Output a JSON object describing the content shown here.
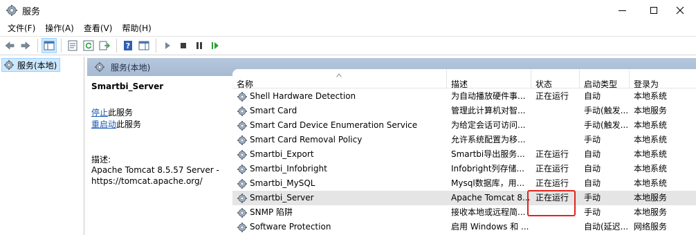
{
  "window": {
    "title": "服务"
  },
  "menu": [
    "文件(F)",
    "操作(A)",
    "查看(V)",
    "帮助(H)"
  ],
  "toolbar": {
    "icons": [
      "back-arrow-icon",
      "forward-arrow-icon",
      "show-console-tree-icon",
      "properties-icon",
      "refresh-icon",
      "export-list-icon",
      "help-icon",
      "show-hide-action-pane-icon",
      "start-service-icon",
      "stop-service-icon",
      "pause-service-icon",
      "restart-service-icon"
    ]
  },
  "tree": {
    "selected_label": "服务(本地)"
  },
  "header": {
    "label": "服务(本地)"
  },
  "extended": {
    "service_name": "Smartbi_Server",
    "stop_link": "停止",
    "stop_suffix": "此服务",
    "restart_link": "重启动",
    "restart_suffix": "此服务",
    "desc_label": "描述:",
    "desc_text": "Apache Tomcat 8.5.57 Server - https://tomcat.apache.org/"
  },
  "columns": {
    "name": "名称",
    "desc": "描述",
    "status": "状态",
    "start": "启动类型",
    "logon": "登录为"
  },
  "services": [
    {
      "name": "Shell Hardware Detection",
      "desc": "为自动播放硬件事...",
      "status": "正在运行",
      "start": "自动",
      "logon": "本地系统"
    },
    {
      "name": "Smart Card",
      "desc": "管理此计算机对智...",
      "status": "",
      "start": "手动(触发...",
      "logon": "本地服务"
    },
    {
      "name": "Smart Card Device Enumeration Service",
      "desc": "为给定会话可访问...",
      "status": "",
      "start": "手动(触发...",
      "logon": "本地系统"
    },
    {
      "name": "Smart Card Removal Policy",
      "desc": "允许系统配置为移...",
      "status": "",
      "start": "手动",
      "logon": "本地系统"
    },
    {
      "name": "Smartbi_Export",
      "desc": "Smartbi导出服务...",
      "status": "正在运行",
      "start": "自动",
      "logon": "本地系统"
    },
    {
      "name": "Smartbi_Infobright",
      "desc": "Infobright列存储...",
      "status": "正在运行",
      "start": "自动",
      "logon": "本地系统"
    },
    {
      "name": "Smartbi_MySQL",
      "desc": "Mysql数据库，用...",
      "status": "正在运行",
      "start": "自动",
      "logon": "本地系统"
    },
    {
      "name": "Smartbi_Server",
      "desc": "Apache Tomcat 8....",
      "status": "正在运行",
      "start": "手动",
      "logon": "本地服务"
    },
    {
      "name": "SNMP 陷阱",
      "desc": "接收本地或远程简...",
      "status": "",
      "start": "手动",
      "logon": "本地服务"
    },
    {
      "name": "Software Protection",
      "desc": "启用 Windows 和 ...",
      "status": "",
      "start": "自动(延迟...",
      "logon": "网络服务"
    }
  ],
  "selected_index": 7,
  "colors": {
    "header_bg": "#b5c7dc",
    "link": "#1b59b5",
    "highlight": "#e0231b",
    "selected_row": "#e5e5e5"
  }
}
